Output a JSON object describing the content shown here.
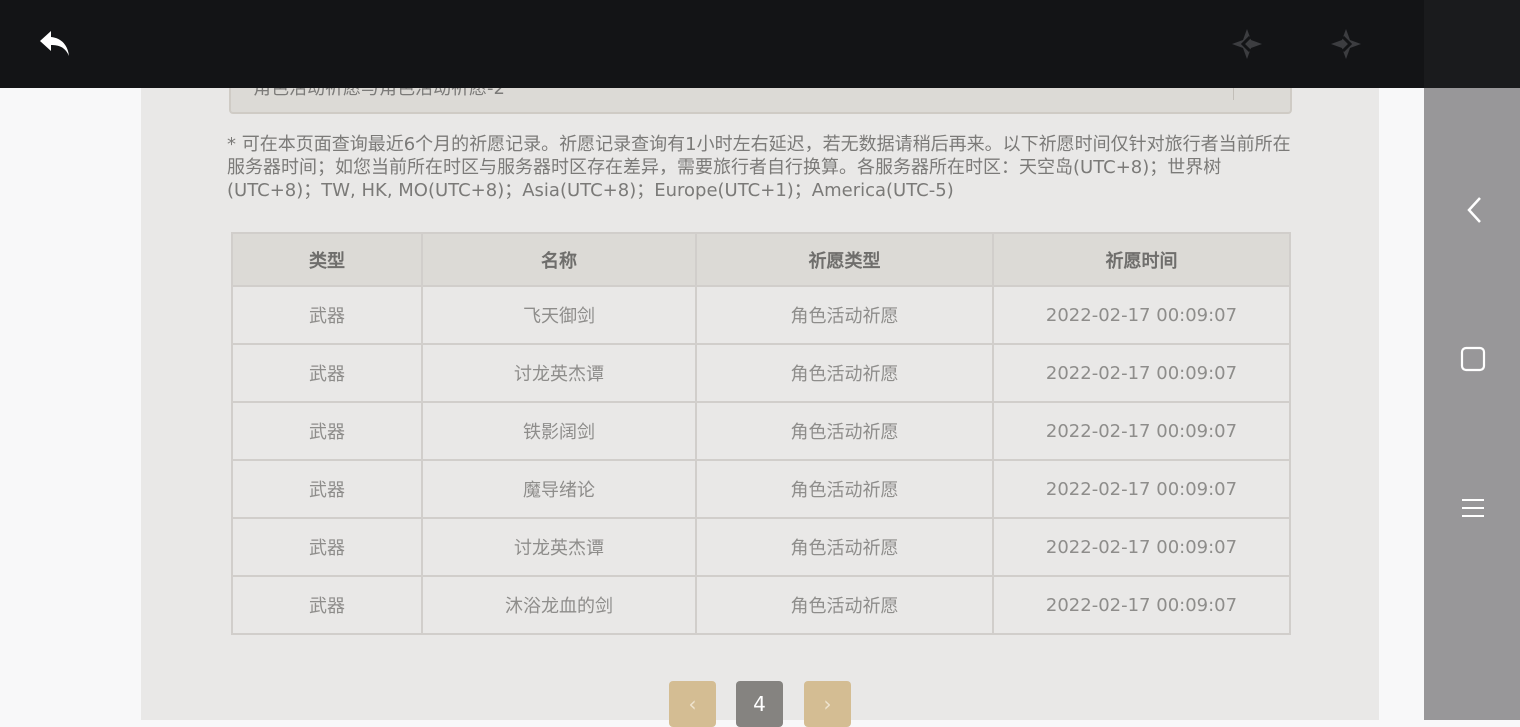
{
  "wish_type_select": {
    "value": "角色活动祈愿与角色活动祈愿-2"
  },
  "notice": "* 可在本页面查询最近6个月的祈愿记录。祈愿记录查询有1小时左右延迟，若无数据请稍后再来。以下祈愿时间仅针对旅行者当前所在服务器时间；如您当前所在时区与服务器时区存在差异，需要旅行者自行换算。各服务器所在时区：天空岛(UTC+8)；世界树(UTC+8)；TW, HK, MO(UTC+8)；Asia(UTC+8)；Europe(UTC+1)；America(UTC-5)",
  "table": {
    "headers": [
      "类型",
      "名称",
      "祈愿类型",
      "祈愿时间"
    ],
    "rows": [
      [
        "武器",
        "飞天御剑",
        "角色活动祈愿",
        "2022-02-17 00:09:07"
      ],
      [
        "武器",
        "讨龙英杰谭",
        "角色活动祈愿",
        "2022-02-17 00:09:07"
      ],
      [
        "武器",
        "铁影阔剑",
        "角色活动祈愿",
        "2022-02-17 00:09:07"
      ],
      [
        "武器",
        "魔导绪论",
        "角色活动祈愿",
        "2022-02-17 00:09:07"
      ],
      [
        "武器",
        "讨龙英杰谭",
        "角色活动祈愿",
        "2022-02-17 00:09:07"
      ],
      [
        "武器",
        "沐浴龙血的剑",
        "角色活动祈愿",
        "2022-02-17 00:09:07"
      ]
    ]
  },
  "pagination": {
    "prev": "‹",
    "current": "4",
    "next": "›"
  },
  "icons": {
    "back": "back-arrow-icon",
    "nav_prev": "prev-star-icon",
    "nav_next": "next-star-icon",
    "refresh": "refresh-icon",
    "side_back": "chevron-left-icon",
    "side_home": "square-icon",
    "side_menu": "menu-icon"
  },
  "colors": {
    "topbar": "#131416",
    "panel": "#e9e8e7",
    "gold": "#d4bd93"
  }
}
